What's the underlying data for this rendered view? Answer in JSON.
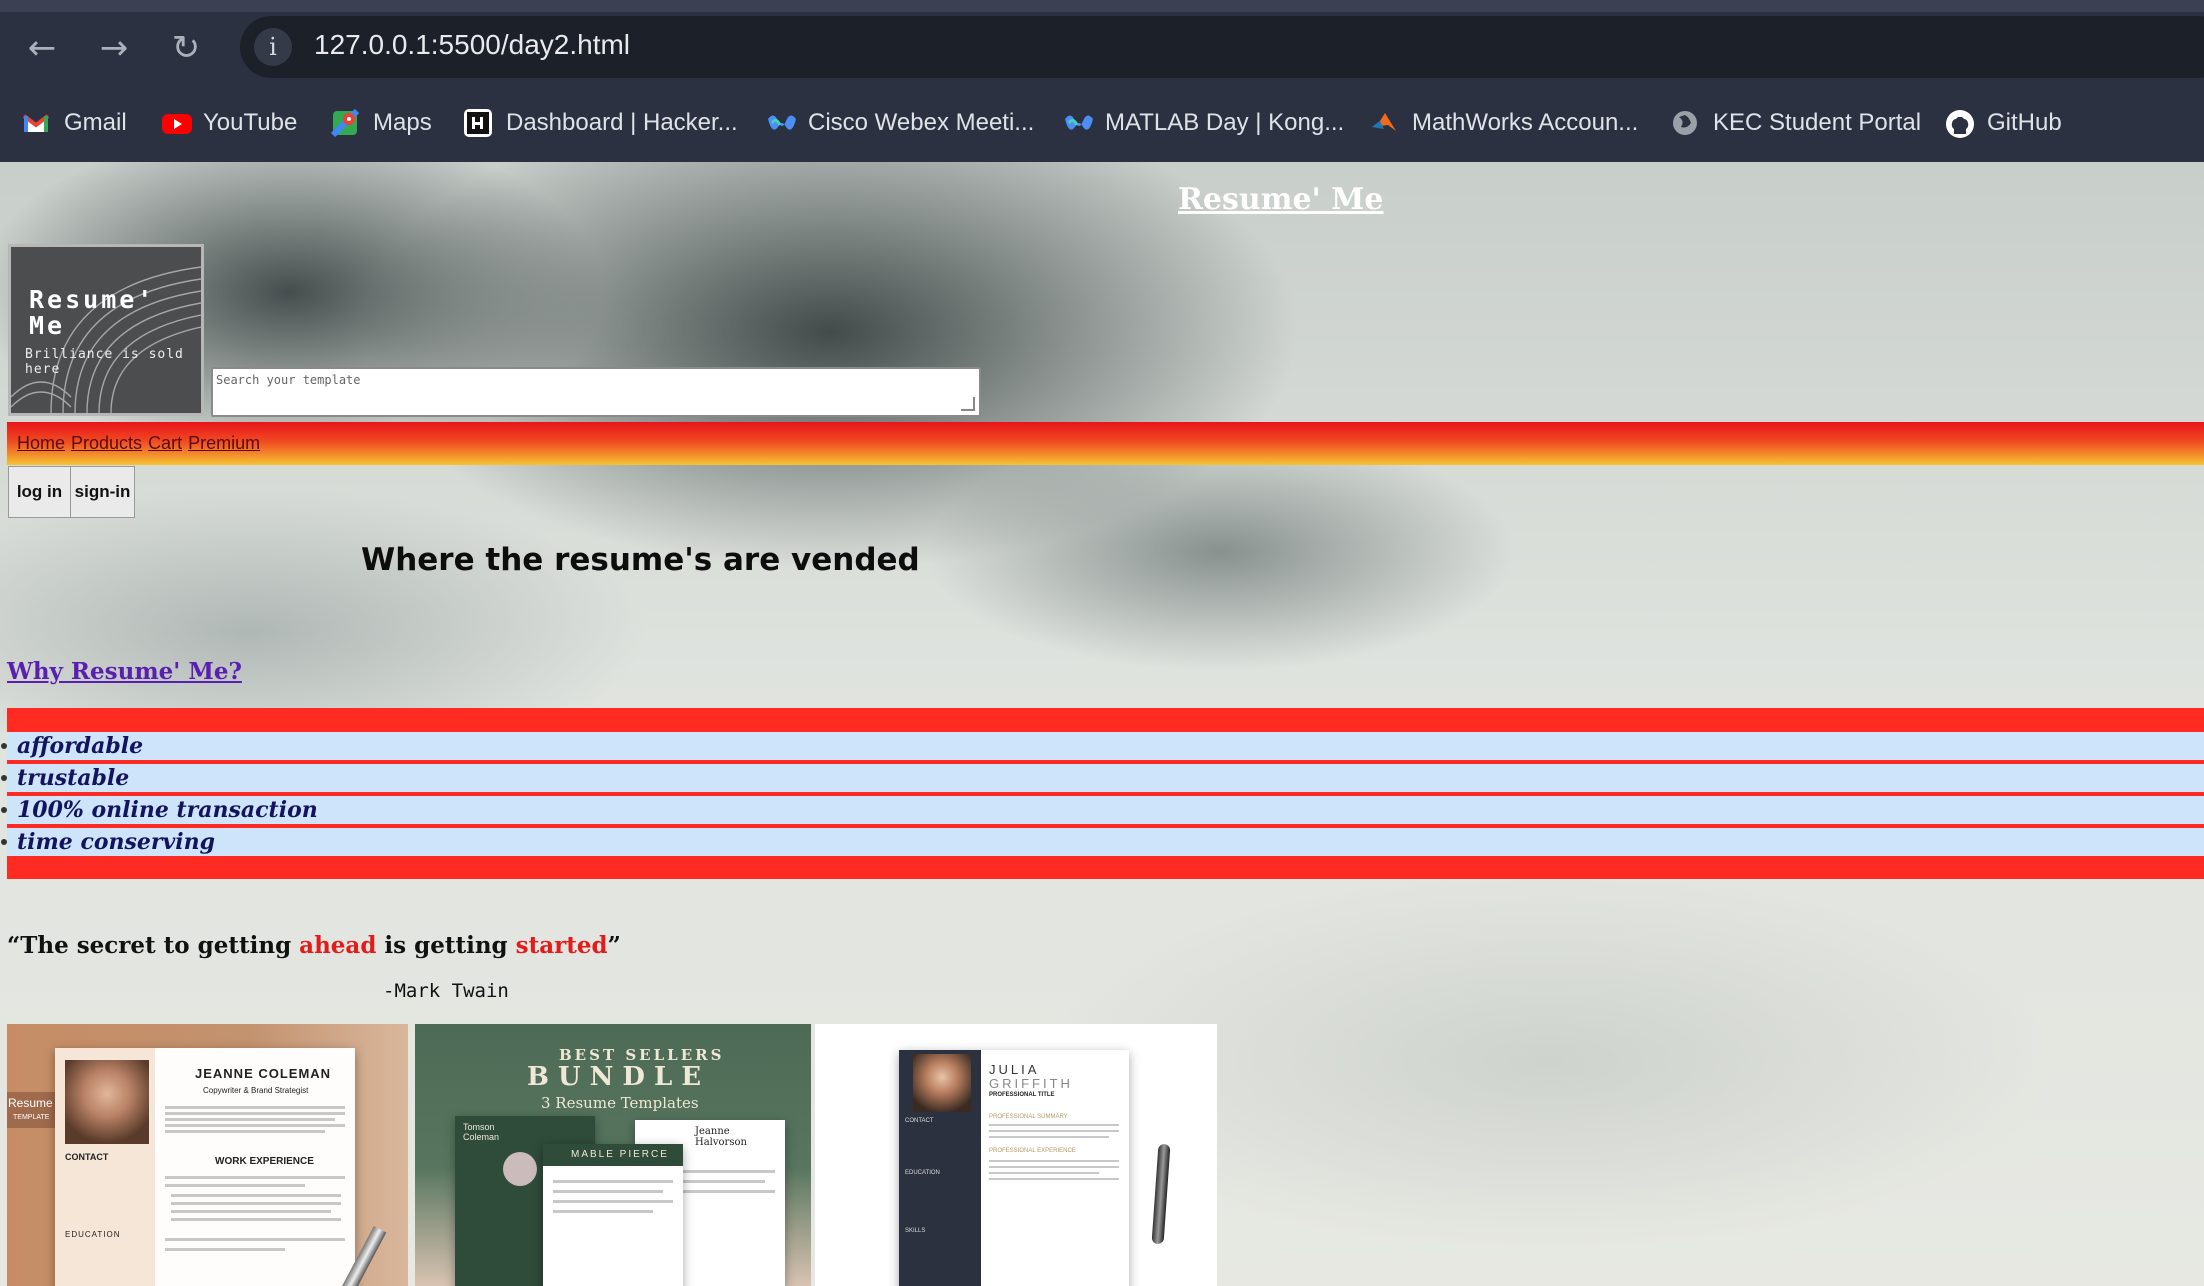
{
  "browser": {
    "url": "127.0.0.1:5500/day2.html",
    "bookmarks": [
      {
        "label": "Gmail",
        "icon": "gmail-icon",
        "color": "#ea4335"
      },
      {
        "label": "YouTube",
        "icon": "youtube-icon",
        "color": "#ff0000"
      },
      {
        "label": "Maps",
        "icon": "maps-icon",
        "color": "#34a853"
      },
      {
        "label": "Dashboard | Hacker...",
        "icon": "hackerrank-icon",
        "color": "#ffffff"
      },
      {
        "label": "Cisco Webex Meeti...",
        "icon": "webex-icon",
        "color": "#4c8df6"
      },
      {
        "label": "MATLAB Day | Kong...",
        "icon": "webex-icon",
        "color": "#4c8df6"
      },
      {
        "label": "MathWorks Accoun...",
        "icon": "matlab-icon",
        "color": "#f06b1f"
      },
      {
        "label": "KEC Student Portal",
        "icon": "globe-icon",
        "color": "#9aa0a6"
      },
      {
        "label": "GitHub",
        "icon": "github-icon",
        "color": "#ffffff"
      }
    ]
  },
  "site": {
    "title": "Resume' Me",
    "logo_line1": "Resume'",
    "logo_line2": "Me",
    "logo_sub": "Brilliance is sold here",
    "search_placeholder": "Search your template",
    "nav": [
      "Home",
      "Products",
      "Cart",
      "Premium"
    ],
    "login_label": "log in",
    "signin_label": "sign-in",
    "tagline": "Where the resume's are vended",
    "why_link": "Why Resume' Me?",
    "features": [
      "affordable",
      "trustable",
      "100% online transaction",
      "time conserving"
    ],
    "quote": {
      "open": "“The secret to getting ",
      "red1": "ahead",
      "mid": " is getting ",
      "red2": "started",
      "close": "”",
      "author": "-Mark Twain"
    },
    "templates": [
      {
        "name": "JEANNE COLEMAN",
        "subtitle": "Copywriter & Brand Strategist",
        "side_label": "Resume",
        "side_label2": "TEMPLATE",
        "section": "WORK EXPERIENCE",
        "contact": "CONTACT",
        "education": "EDUCATION"
      },
      {
        "line1": "BEST SELLERS",
        "line2": "BUNDLE",
        "line3": "3 Resume Templates",
        "name_a": "Tomson Coleman",
        "name_b": "MABLE PIERCE",
        "name_c": "Jeanne Halvorson"
      },
      {
        "first": "JULIA",
        "last": "GRIFFITH",
        "title": "PROFESSIONAL TITLE",
        "summary": "PROFESSIONAL SUMMARY",
        "experience": "PROFESSIONAL EXPERIENCE",
        "contact": "CONTACT",
        "education": "EDUCATION",
        "skills": "SKILLS"
      }
    ]
  }
}
